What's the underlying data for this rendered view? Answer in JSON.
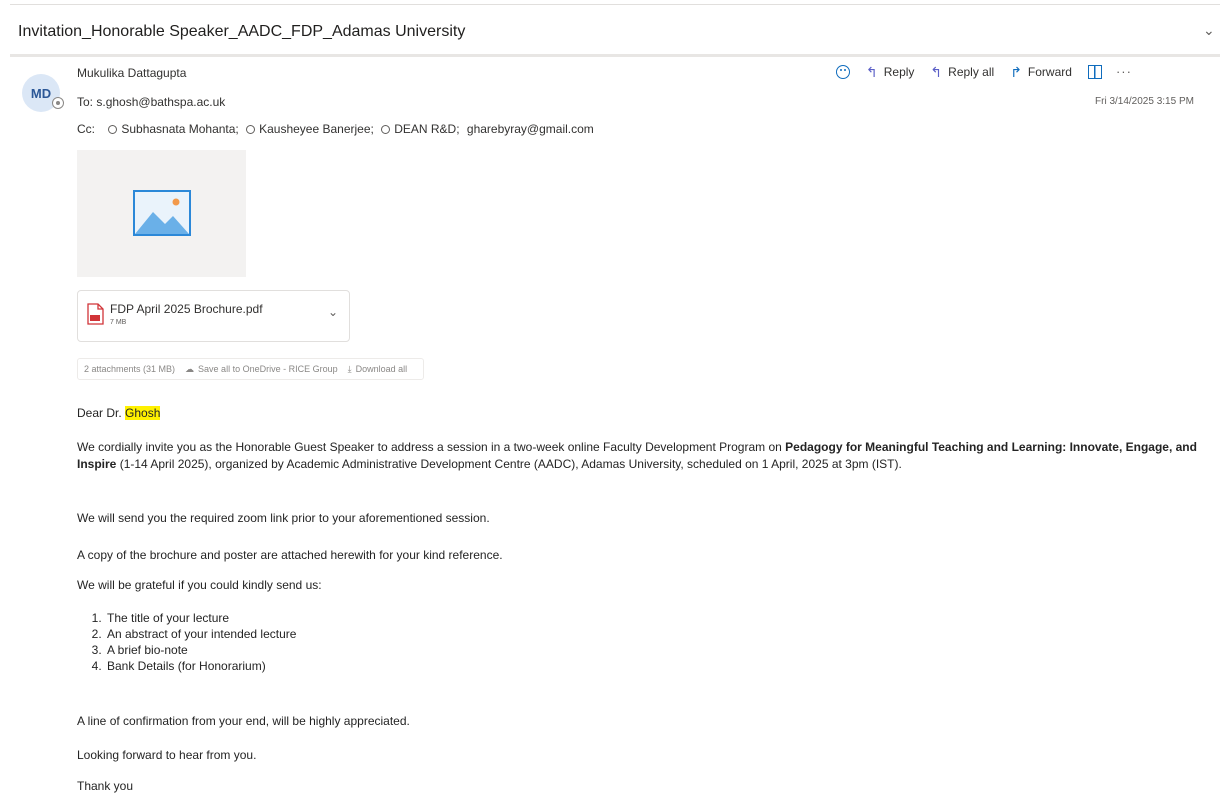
{
  "subject": "Invitation_Honorable Speaker_AADC_FDP_Adamas University",
  "sender": {
    "initials": "MD",
    "name": "Mukulika Dattagupta"
  },
  "to": {
    "label": "To:",
    "address": "s.ghosh@bathspa.ac.uk"
  },
  "cc": {
    "label": "Cc:",
    "recipients": [
      "Subhasnata Mohanta;",
      "Kausheyee Banerjee;",
      "DEAN R&D;",
      "gharebyray@gmail.com"
    ]
  },
  "actions": {
    "reply": "Reply",
    "reply_all": "Reply all",
    "forward": "Forward",
    "more": "···"
  },
  "date": "Fri 3/14/2025 3:15 PM",
  "attachment": {
    "name": "FDP April 2025 Brochure.pdf",
    "size": "7 MB"
  },
  "attachment_bar": {
    "count": "2 attachments (31 MB)",
    "save": "Save all to OneDrive - RICE Group",
    "download": "Download all"
  },
  "body": {
    "greeting_prefix": "Dear Dr.",
    "greeting_name": "Ghosh",
    "para1_a": "We cordially invite you as the Honorable Guest Speaker to address a session in a two-week online Faculty Development Program on ",
    "para1_bold": "Pedagogy for Meaningful Teaching and Learning: Innovate, Engage, and Inspire",
    "para1_b": " (1-14 April 2025), organized by Academic Administrative Development Centre (AADC), Adamas University, scheduled on 1 April, 2025 at 3pm (IST).",
    "zoom": "We will send you the required zoom link prior to your aforementioned session.",
    "copy": "A copy of the brochure and poster are attached herewith for your kind reference.",
    "grateful": "We will be grateful if you could kindly send us:",
    "list": [
      "The title of your lecture",
      "An abstract  of your intended lecture",
      "A brief bio-note",
      "Bank Details (for Honorarium)"
    ],
    "confirm": "A line of confirmation from your end, will be highly appreciated.",
    "looking": "Looking forward to hear from you.",
    "thanks": "Thank you"
  }
}
